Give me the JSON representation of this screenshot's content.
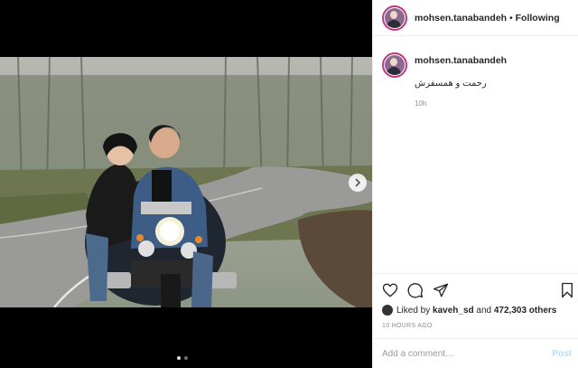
{
  "header": {
    "username": "mohsen.tanabandeh",
    "separator": " • ",
    "follow_status": "Following"
  },
  "caption": {
    "username": "mohsen.tanabandeh",
    "text": "رحمت و همسفرش",
    "time": "10h"
  },
  "likes": {
    "prefix": "Liked by ",
    "user": "kaveh_sd",
    "middle": " and ",
    "count": "472,303 others"
  },
  "timestamp": "10 HOURS AGO",
  "comment": {
    "placeholder": "Add a comment…",
    "post_label": "Post"
  },
  "carousel": {
    "slides": 2,
    "active": 1
  },
  "icons": [
    "heart-icon",
    "comment-icon",
    "share-icon",
    "bookmark-icon",
    "chevron-right-icon"
  ],
  "colors": {
    "story_ring": "#c13584",
    "post_button_disabled": "#b2dffc",
    "secondary_text": "#8e8e8e"
  }
}
